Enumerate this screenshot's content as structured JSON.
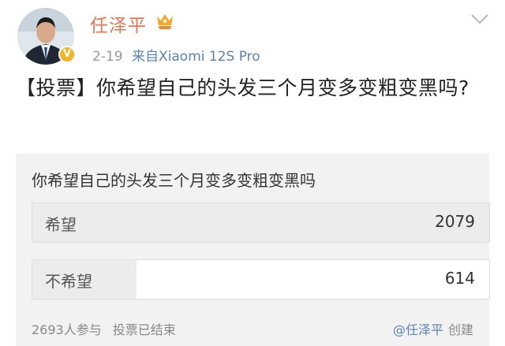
{
  "post": {
    "username": "任泽平",
    "rank_icon": "crown-badge-icon",
    "verified_icon": "v-verified-icon",
    "time": "2-19",
    "source_prefix": "来自",
    "source_device": "Xiaomi 12S Pro",
    "text": "【投票】你希望自己的头发三个月变多变粗变黑吗?"
  },
  "poll": {
    "question": "你希望自己的头发三个月变多变粗变黑吗",
    "options": [
      {
        "label": "希望",
        "count": "2079",
        "share": 1.0
      },
      {
        "label": "不希望",
        "count": "614",
        "share": 0.228
      }
    ],
    "participants": "2693人参与",
    "status": "投票已结束",
    "creator": "@任泽平",
    "created_label": "创建"
  },
  "colors": {
    "username": "#eb7350",
    "link": "#5b83b5",
    "poll_bg": "#f2f2f2",
    "bar_fill": "#ececec",
    "badge": "#f5b324"
  }
}
